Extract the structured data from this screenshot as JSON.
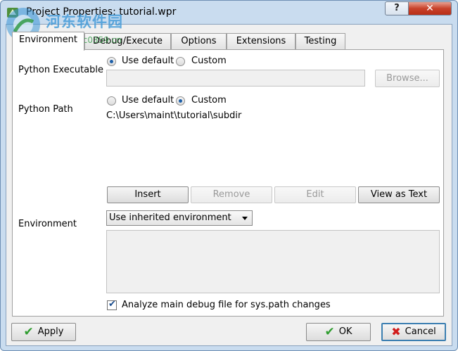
{
  "window": {
    "title": "Project Properties: tutorial.wpr",
    "help_label": "?",
    "close_label": "✕"
  },
  "tabs": [
    {
      "label": "Environment",
      "active": true
    },
    {
      "label": "Debug/Execute",
      "active": false
    },
    {
      "label": "Options",
      "active": false
    },
    {
      "label": "Extensions",
      "active": false
    },
    {
      "label": "Testing",
      "active": false
    }
  ],
  "python_executable": {
    "label": "Python Executable",
    "use_default": "Use default",
    "custom": "Custom",
    "selected": "Use default",
    "path_value": "",
    "browse": "Browse..."
  },
  "python_path": {
    "label": "Python Path",
    "use_default": "Use default",
    "custom": "Custom",
    "selected": "Custom",
    "entries": [
      "C:\\Users\\maint\\tutorial\\subdir"
    ],
    "buttons": {
      "insert": "Insert",
      "remove": "Remove",
      "edit": "Edit",
      "view_as_text": "View as Text"
    }
  },
  "environment": {
    "label": "Environment",
    "selected_option": "Use inherited environment",
    "text_value": ""
  },
  "analyze": {
    "label": "Analyze main debug file for sys.path changes",
    "checked": true
  },
  "footer": {
    "apply": "Apply",
    "ok": "OK",
    "cancel": "Cancel"
  },
  "watermark": {
    "text": "河东软件园",
    "url": "www.pc0359.cn"
  },
  "colors": {
    "accent": "#1d5fa8",
    "ok_icon": "#2f9d2f",
    "cancel_icon": "#d11c1c",
    "close_button": "#c8422b"
  }
}
